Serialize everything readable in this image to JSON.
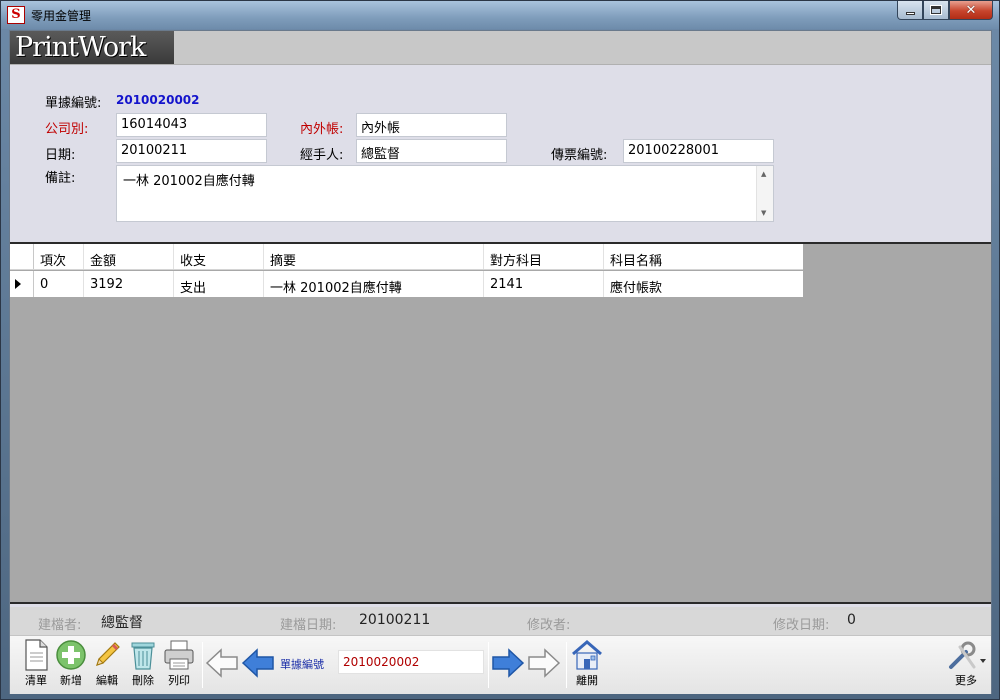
{
  "window": {
    "title": "零用金管理",
    "icon_glyph": "S"
  },
  "header": {
    "logo_text": "PrintWork"
  },
  "form": {
    "doc_no_label": "單據編號:",
    "doc_no_value": "2010020002",
    "company_label": "公司別:",
    "company_value": "16014043",
    "inner_outer_label": "內外帳:",
    "inner_outer_value": "內外帳",
    "date_label": "日期:",
    "date_value": "20100211",
    "handler_label": "經手人:",
    "handler_value": "總監督",
    "voucher_label": "傳票編號:",
    "voucher_value": "20100228001",
    "note_label": "備註:",
    "note_value": "一林 201002自應付轉"
  },
  "grid": {
    "columns": [
      "項次",
      "金額",
      "收支",
      "摘要",
      "對方科目",
      "科目名稱"
    ],
    "rows": [
      [
        "0",
        "3192",
        "支出",
        "一林 201002自應付轉",
        "2141",
        "應付帳款"
      ]
    ]
  },
  "audit": {
    "creator_label": "建檔者:",
    "creator_value": "總監督",
    "create_date_label": "建檔日期:",
    "create_date_value": "20100211",
    "modifier_label": "修改者:",
    "modifier_value": "",
    "modify_date_label": "修改日期:",
    "modify_date_value": "0"
  },
  "toolbar": {
    "clear_label": "清單",
    "add_label": "新增",
    "edit_label": "編輯",
    "delete_label": "刪除",
    "print_label": "列印",
    "nav_label": "單據編號",
    "nav_value": "2010020002",
    "exit_label": "離開",
    "more_label": "更多"
  },
  "icons": {
    "clear": "document-icon",
    "add": "plus-circle-icon",
    "edit": "pencil-icon",
    "delete": "trash-icon",
    "print": "printer-icon",
    "first": "arrow-left-outline-icon",
    "prev": "arrow-left-blue-icon",
    "next": "arrow-right-blue-icon",
    "last": "arrow-right-outline-icon",
    "exit": "house-icon",
    "more": "tools-icon"
  },
  "colors": {
    "required_label": "#c00000",
    "doc_no": "#1414cc",
    "nav_value": "#b00000",
    "nav_arrow": "#3f7fd9"
  }
}
